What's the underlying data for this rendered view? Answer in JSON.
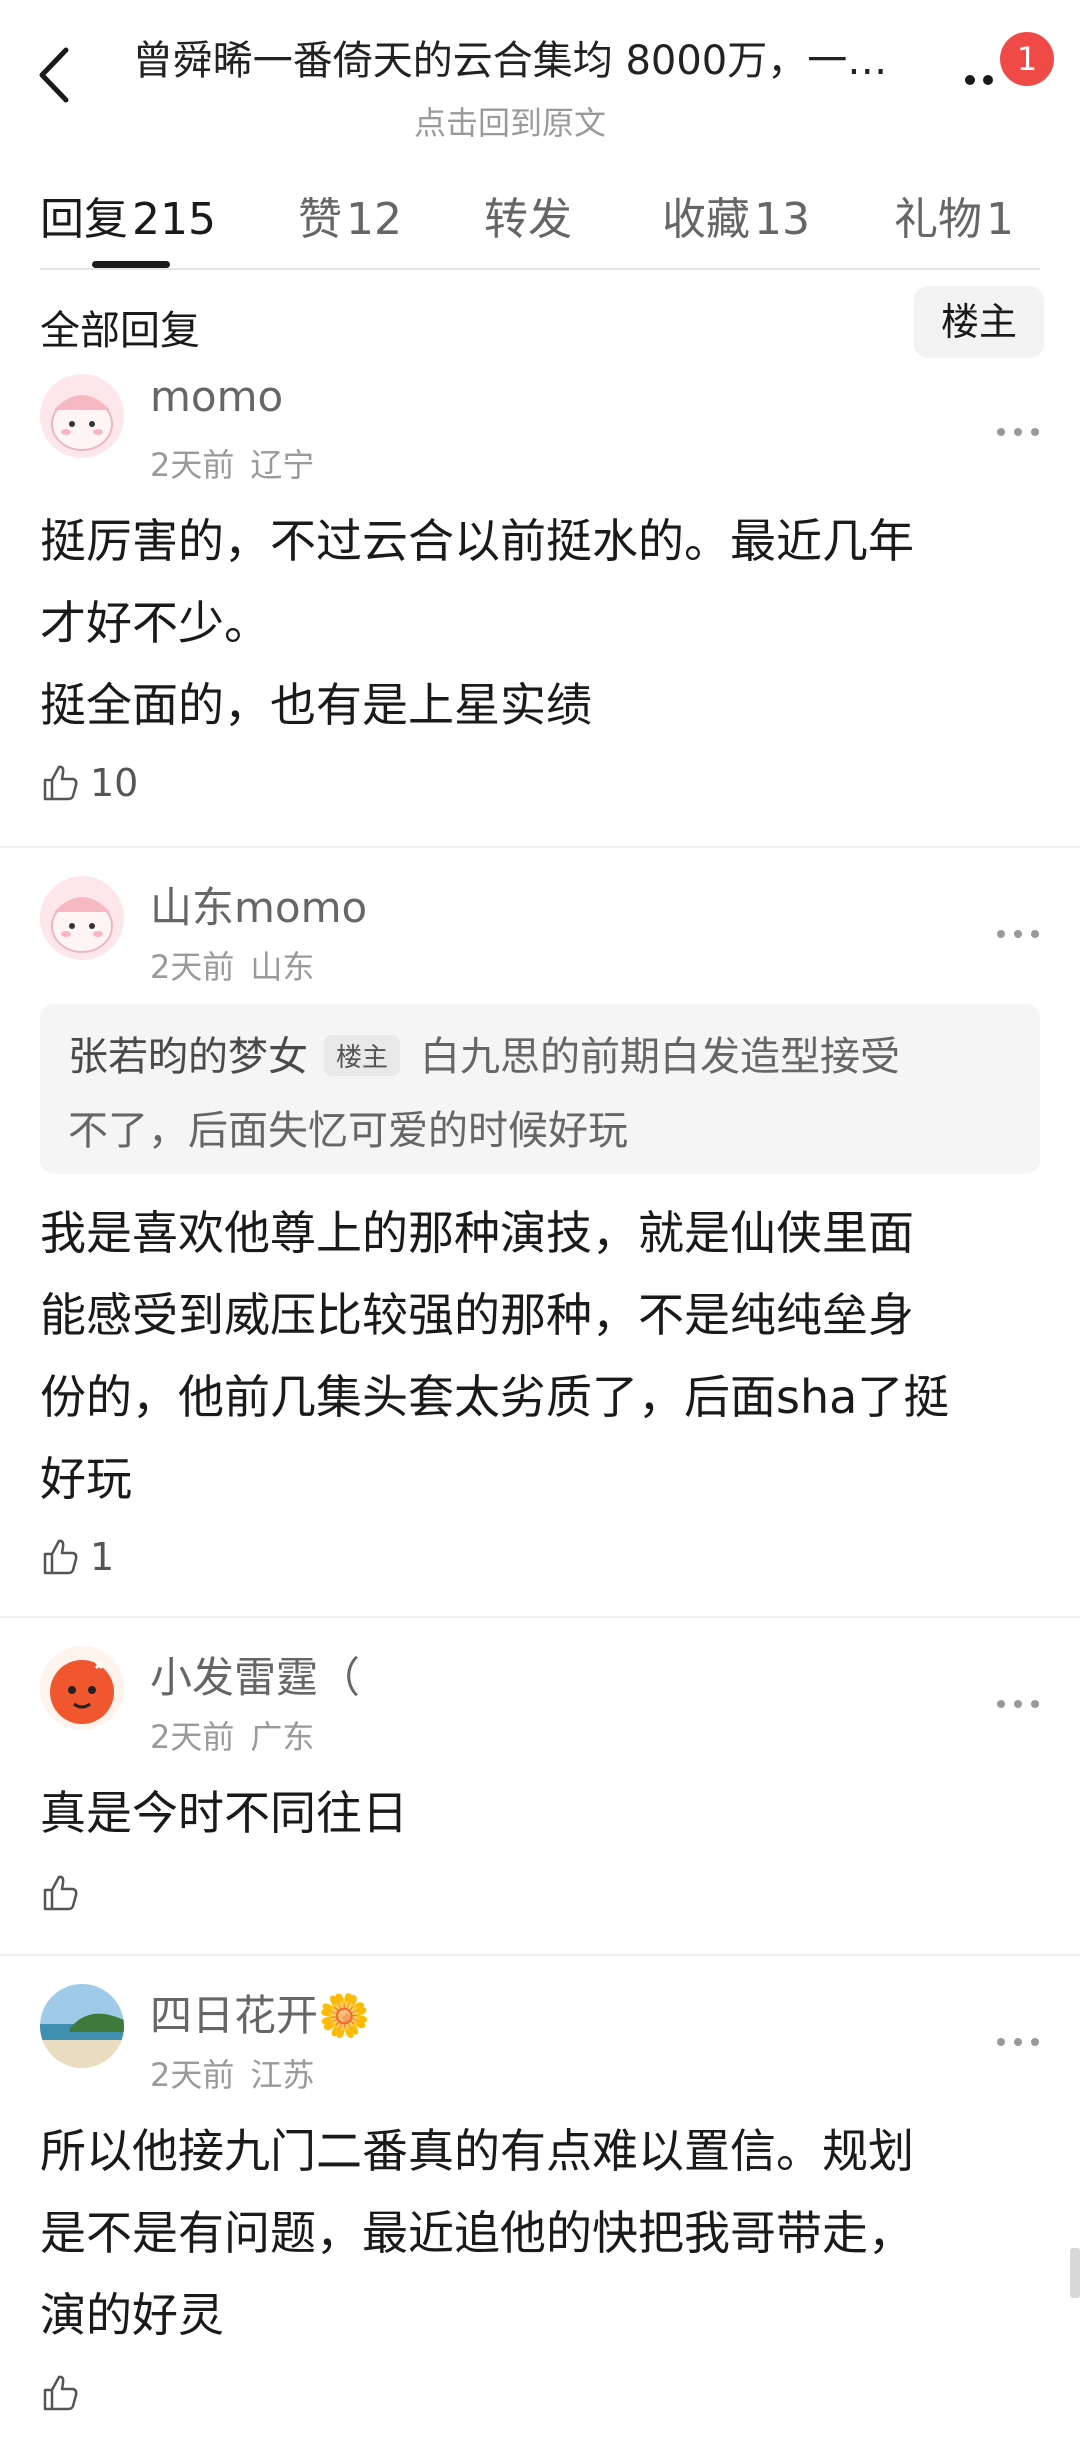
{
  "header": {
    "title": "曾舜晞一番倚天的云合集均 8000万，一…",
    "subtitle": "点击回到原文",
    "badge_count": "1"
  },
  "tabs": [
    {
      "label": "回复",
      "count": "215",
      "active": true
    },
    {
      "label": "赞",
      "count": "12",
      "active": false
    },
    {
      "label": "转发",
      "count": "",
      "active": false
    },
    {
      "label": "收藏",
      "count": "13",
      "active": false
    },
    {
      "label": "礼物",
      "count": "1",
      "active": false
    }
  ],
  "filter": {
    "label": "全部回复",
    "op_button": "楼主"
  },
  "comments": [
    {
      "username": "momo",
      "time": "2天前",
      "location": "辽宁",
      "lines": [
        "挺厉害的，不过云合以前挺水的。最近几年",
        "才好不少。",
        "挺全面的，也有是上星实绩"
      ],
      "likes": "10"
    },
    {
      "username": "山东momo",
      "time": "2天前",
      "location": "山东",
      "quote": {
        "user": "张若昀的梦女",
        "badge": "楼主",
        "line1": "白九思的前期白发造型接受",
        "line2": "不了，后面失忆可爱的时候好玩"
      },
      "lines": [
        "我是喜欢他尊上的那种演技，就是仙侠里面",
        "能感受到威压比较强的那种，不是纯纯垒身",
        "份的，他前几集头套太劣质了，后面sha了挺",
        "好玩"
      ],
      "likes": "1"
    },
    {
      "username": "小发雷霆（",
      "time": "2天前",
      "location": "广东",
      "lines": [
        "真是今时不同往日"
      ],
      "likes": ""
    },
    {
      "username": "四日花开🌼",
      "time": "2天前",
      "location": "江苏",
      "lines": [
        "所以他接九门二番真的有点难以置信。规划",
        "是不是有问题，最近追他的快把我哥带走，",
        "演的好灵"
      ],
      "likes": ""
    }
  ],
  "colors": {
    "badge": "#f04a48",
    "text_primary": "#1a1a1a",
    "text_secondary": "#666666",
    "text_meta": "#9a9a9a",
    "quote_bg": "#f5f5f5"
  }
}
